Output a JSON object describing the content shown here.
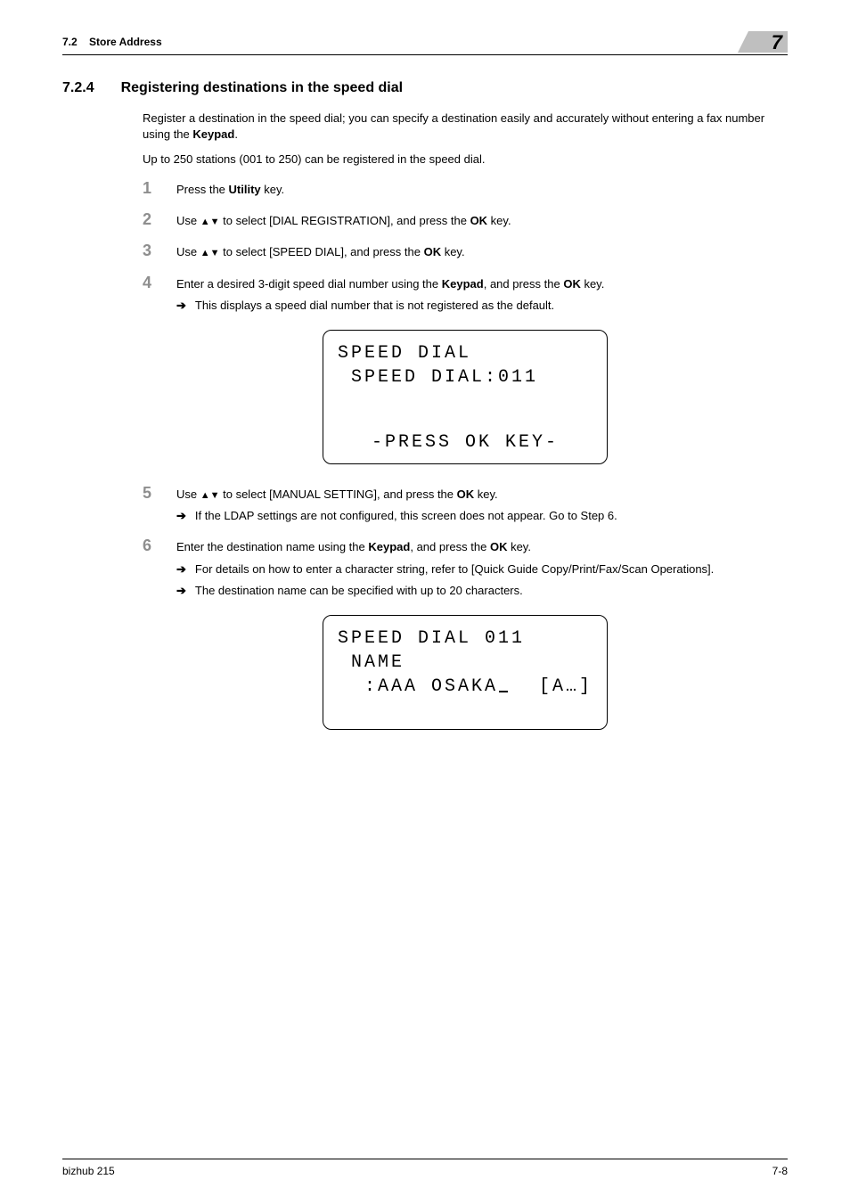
{
  "header": {
    "section_num": "7.2",
    "section_title": "Store Address",
    "chapter_num": "7"
  },
  "heading": {
    "num": "7.2.4",
    "title": "Registering destinations in the speed dial"
  },
  "intro": {
    "p1a": "Register a destination in the speed dial; you can specify a destination easily and accurately without entering a fax number using the ",
    "p1b": "Keypad",
    "p1c": ".",
    "p2": "Up to 250 stations (001 to 250) can be registered in the speed dial."
  },
  "steps": {
    "s1": {
      "num": "1",
      "a": "Press the ",
      "b": "Utility",
      "c": " key."
    },
    "s2": {
      "num": "2",
      "a": "Use ",
      "b": " to select [DIAL REGISTRATION], and press the ",
      "c": "OK",
      "d": " key."
    },
    "s3": {
      "num": "3",
      "a": "Use ",
      "b": " to select [SPEED DIAL], and press the ",
      "c": "OK",
      "d": " key."
    },
    "s4": {
      "num": "4",
      "a": "Enter a desired 3-digit speed dial number using the ",
      "b": "Keypad",
      "c": ", and press the ",
      "d": "OK",
      "e": " key.",
      "note": "This displays a speed dial number that is not registered as the default."
    },
    "s5": {
      "num": "5",
      "a": "Use ",
      "b": " to select [MANUAL SETTING], and press the ",
      "c": "OK",
      "d": " key.",
      "note": "If the LDAP settings are not configured, this screen does not appear. Go to Step 6."
    },
    "s6": {
      "num": "6",
      "a": "Enter the destination name using the ",
      "b": "Keypad",
      "c": ", and press the ",
      "d": "OK",
      "e": " key.",
      "note1": "For details on how to enter a character string, refer to [Quick Guide Copy/Print/Fax/Scan Operations].",
      "note2": "The destination name can be specified with up to 20 characters."
    }
  },
  "lcd1": {
    "l1": "SPEED DIAL",
    "l2": " SPEED DIAL:011",
    "l3": "-PRESS OK KEY-"
  },
  "lcd2": {
    "l1": "SPEED DIAL 011",
    "l2": " NAME",
    "l3a": "  :AAA OSAKA",
    "l3b": "[A…]"
  },
  "footer": {
    "left": "bizhub 215",
    "right": "7-8"
  },
  "arrow_symbol": "➔"
}
